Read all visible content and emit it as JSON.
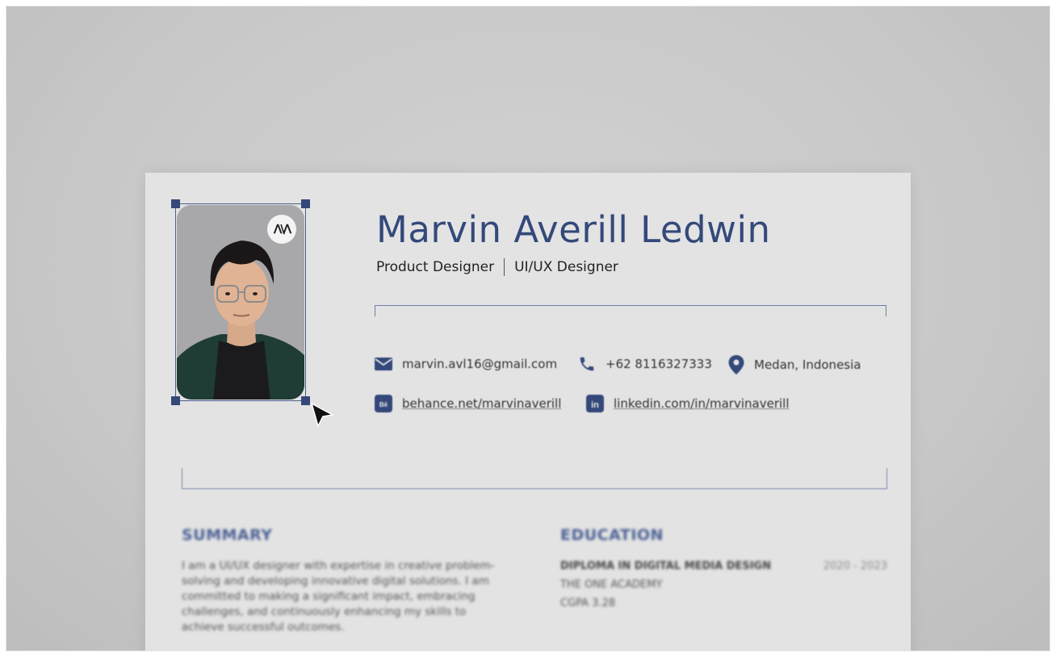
{
  "resume": {
    "name": "Marvin Averill Ledwin",
    "role_primary": "Product Designer",
    "role_secondary": "UI/UX Designer",
    "logo_text": "ꓥ\\ꓥ",
    "contacts": {
      "email": "marvin.avl16@gmail.com",
      "phone": "+62 8116327333",
      "location": "Medan, Indonesia",
      "behance": "behance.net/marvinaverill",
      "linkedin": "linkedin.com/in/marvinaverill"
    },
    "summary": {
      "title": "SUMMARY",
      "text": "I am a UI/UX designer with expertise in creative problem-solving and developing innovative digital solutions. I am committed to making a significant impact, embracing challenges, and continuously enhancing my skills to achieve successful outcomes."
    },
    "education": {
      "title": "EDUCATION",
      "degree": "DIPLOMA IN DIGITAL MEDIA DESIGN",
      "years": "2020 - 2023",
      "school": "THE ONE ACADEMY",
      "gpa": "CGPA 3.28"
    }
  },
  "colors": {
    "accent": "#34497a",
    "backdrop": "#c9c9c9",
    "paper": "#e3e3e3"
  },
  "icons": {
    "email": "mail-icon",
    "phone": "phone-icon",
    "location": "map-pin-icon",
    "behance": "behance-icon",
    "linkedin": "linkedin-icon",
    "cursor": "mouse-pointer-icon"
  }
}
